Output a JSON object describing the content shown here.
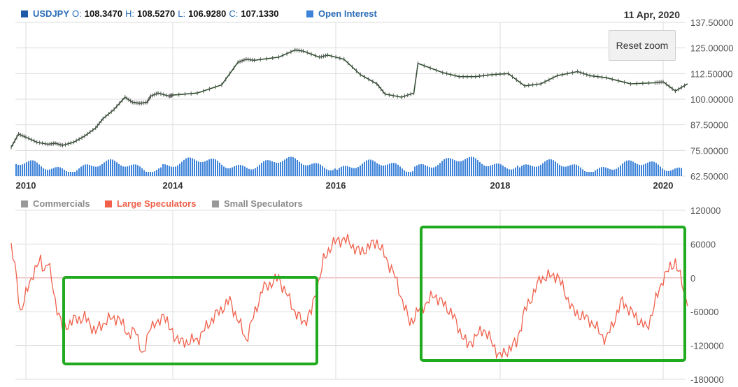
{
  "header": {
    "symbol": "USDJPY",
    "open_label": "O:",
    "open": "108.3470",
    "high_label": "H:",
    "high": "108.5270",
    "low_label": "L:",
    "low": "106.9280",
    "close_label": "C:",
    "close": "107.1330",
    "open_interest_label": "Open Interest",
    "date": "11 Apr, 2020"
  },
  "reset_zoom_label": "Reset zoom",
  "cot_legend": {
    "commercials": "Commercials",
    "large_speculators": "Large Speculators",
    "small_speculators": "Small Speculators"
  },
  "colors": {
    "price_series": "#2a6db7",
    "open_interest": "#3d83d9",
    "large_speculators": "#f0604b",
    "commercials": "#999999",
    "small_speculators": "#999999",
    "annotation_box": "#1faa1f",
    "zero_line": "#e6a0a0"
  },
  "chart_data": [
    {
      "type": "line",
      "name": "USDJPY",
      "x_ticks": [
        "2010",
        "2014",
        "2016",
        "2018",
        "2020"
      ],
      "ylim": [
        62.5,
        137.5
      ],
      "y_ticks": [
        "137.50000",
        "125.00000",
        "112.50000",
        "100.00000",
        "87.50000",
        "75.00000",
        "62.50000"
      ],
      "x": [
        2009.6,
        2009.8,
        2010.0,
        2010.3,
        2010.6,
        2010.8,
        2011.0,
        2011.3,
        2011.6,
        2011.9,
        2012.1,
        2012.4,
        2012.7,
        2012.9,
        2013.1,
        2013.3,
        2013.4,
        2013.6,
        2013.9,
        2014.0,
        2014.3,
        2014.6,
        2014.8,
        2014.9,
        2015.0,
        2015.3,
        2015.5,
        2015.6,
        2015.8,
        2015.9,
        2016.1,
        2016.3,
        2016.5,
        2016.6,
        2016.8,
        2016.95,
        2017.0,
        2017.3,
        2017.5,
        2017.7,
        2017.9,
        2018.1,
        2018.3,
        2018.5,
        2018.7,
        2018.95,
        2019.1,
        2019.3,
        2019.6,
        2019.9,
        2020.0,
        2020.15,
        2020.3
      ],
      "values": [
        76.5,
        83.0,
        81.5,
        79.0,
        78.0,
        78.5,
        77.5,
        79.0,
        82.0,
        86.0,
        90.5,
        95.0,
        101.0,
        98.5,
        98.0,
        98.5,
        101.5,
        103.0,
        101.5,
        102.0,
        103.0,
        107.0,
        118.0,
        119.5,
        119.0,
        120.5,
        124.0,
        123.5,
        120.5,
        121.5,
        119.5,
        112.0,
        107.5,
        102.5,
        101.0,
        103.0,
        117.5,
        113.0,
        111.0,
        111.0,
        112.0,
        112.5,
        106.5,
        107.5,
        111.5,
        113.5,
        111.5,
        110.5,
        107.5,
        108.0,
        108.5,
        104.0,
        107.5
      ]
    },
    {
      "type": "bar",
      "name": "Open Interest",
      "note": "Relative open interest bars beneath price panel"
    },
    {
      "type": "line",
      "name": "Large Speculators",
      "ylim": [
        -180000,
        120000
      ],
      "y_ticks": [
        "120000",
        "60000",
        "0",
        "-60000",
        "-120000",
        "-180000"
      ],
      "x": [
        2009.6,
        2009.7,
        2009.85,
        2010.0,
        2010.2,
        2010.4,
        2010.5,
        2010.6,
        2010.8,
        2011.0,
        2011.3,
        2011.6,
        2011.9,
        2012.2,
        2012.5,
        2012.8,
        2013.0,
        2013.2,
        2013.4,
        2013.6,
        2013.75,
        2013.9,
        2014.1,
        2014.3,
        2014.5,
        2014.7,
        2014.9,
        2015.1,
        2015.3,
        2015.5,
        2015.6,
        2015.7,
        2015.85,
        2015.95,
        2016.1,
        2016.3,
        2016.5,
        2016.7,
        2016.9,
        2017.0,
        2017.2,
        2017.4,
        2017.6,
        2017.8,
        2018.0,
        2018.2,
        2018.3,
        2018.5,
        2018.7,
        2018.9,
        2019.1,
        2019.3,
        2019.5,
        2019.6,
        2019.8,
        2020.0,
        2020.15,
        2020.25,
        2020.3
      ],
      "values": [
        55000,
        20000,
        -60000,
        -30000,
        10000,
        30000,
        15000,
        30000,
        -40000,
        -90000,
        -75000,
        -70000,
        -95000,
        -75000,
        -70000,
        -100000,
        -95000,
        -140000,
        -80000,
        -85000,
        -60000,
        -90000,
        -115000,
        -110000,
        -70000,
        -40000,
        -110000,
        -20000,
        0,
        -60000,
        -80000,
        -60000,
        30000,
        60000,
        70000,
        45000,
        65000,
        10000,
        -80000,
        -60000,
        -30000,
        -60000,
        -120000,
        -90000,
        -140000,
        -115000,
        -60000,
        0,
        5000,
        -60000,
        -75000,
        -110000,
        -40000,
        -60000,
        -90000,
        0,
        30000,
        -20000,
        -50000
      ]
    }
  ]
}
